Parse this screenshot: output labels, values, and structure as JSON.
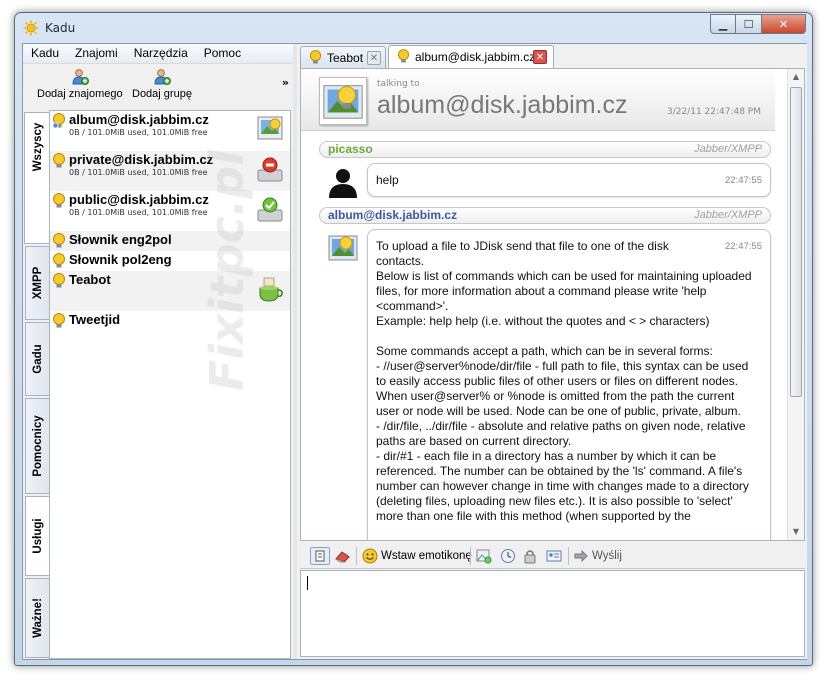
{
  "window": {
    "title": "Kadu"
  },
  "menu": [
    "Kadu",
    "Znajomi",
    "Narzędzia",
    "Pomoc"
  ],
  "toolbar": {
    "add_contact": "Dodaj znajomego",
    "add_group": "Dodaj grupę",
    "more": "»"
  },
  "side_tabs": [
    "Wszyscy",
    "XMPP",
    "Gadu",
    "Pomocnicy",
    "Usługi",
    "Ważne!"
  ],
  "contacts": [
    {
      "name": "album@disk.jabbim.cz",
      "desc": "0B / 101.0MiB used, 101.0MiB free",
      "avatar": "album"
    },
    {
      "name": "private@disk.jabbim.cz",
      "desc": "0B / 101.0MiB used, 101.0MiB free",
      "avatar": "private-disk"
    },
    {
      "name": "public@disk.jabbim.cz",
      "desc": "0B / 101.0MiB used, 101.0MiB free",
      "avatar": "public-disk"
    },
    {
      "name": "Słownik eng2pol",
      "desc": ""
    },
    {
      "name": "Słownik pol2eng",
      "desc": ""
    },
    {
      "name": "Teabot",
      "desc": "",
      "avatar": "tea"
    },
    {
      "name": "Tweetjid",
      "desc": ""
    }
  ],
  "watermark": "Fixitpc.pl",
  "chat_tabs": [
    {
      "label": "Teabot",
      "active": false
    },
    {
      "label": "album@disk.jabbim.cz",
      "active": true
    }
  ],
  "chat": {
    "talking_to": "talking to",
    "contact": "album@disk.jabbim.cz",
    "timestamp": "3/22/11 22:47:48 PM",
    "messages": [
      {
        "sender": "picasso",
        "protocol": "Jabber/XMPP",
        "time": "22:47:55",
        "text": "help",
        "sender_color": "#6aaa3a"
      },
      {
        "sender": "album@disk.jabbim.cz",
        "protocol": "Jabber/XMPP",
        "time": "22:47:55",
        "sender_color": "#3a5aa0",
        "first_line": "To upload a file to JDisk send that file to one of the disk contacts.",
        "text": "Below is list of commands which can be used for maintaining uploaded files, for more information about a command please write 'help <command>'.\nExample: help help (i.e. without the quotes and < > characters)\n\nSome commands accept a path, which can be in several forms:\n- //user@server%node/dir/file - full path to file, this syntax can be used to easily access public files of other users or files on different nodes. When user@server% or %node is omitted from the path the current user or node will be used. Node can be one of public, private, album.\n- /dir/file, ../dir/file - absolute and relative paths on given node, relative paths are based on current directory.\n- dir/#1 - each file in a directory has a number by which it can be referenced. The number can be obtained by the 'ls' command. A file's number can however change in time with changes made to a directory (deleting files, uploading new files etc.). It is also possible to 'select' more than one file with this method (when supported by the"
      }
    ]
  },
  "input_toolbar": {
    "emoticon": "Wstaw emotikonę",
    "send": "Wyślij"
  },
  "colors": {
    "accent": "#3a5aa0",
    "green": "#6aaa3a"
  }
}
